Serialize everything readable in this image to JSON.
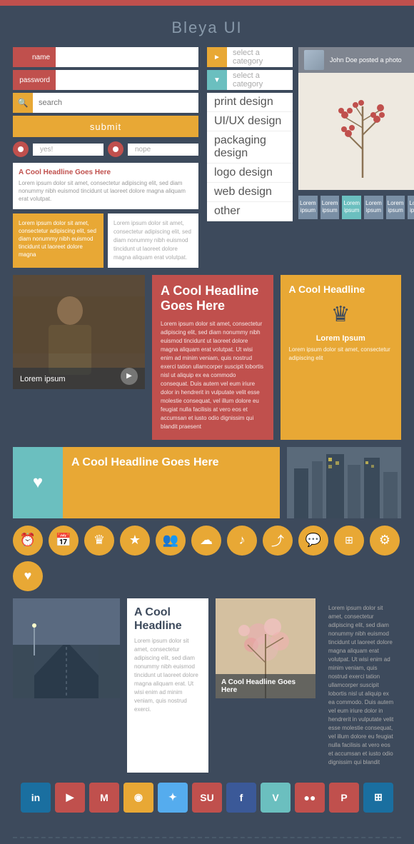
{
  "page": {
    "title": "Bleya UI"
  },
  "colors": {
    "red": "#c0504d",
    "yellow": "#e8a835",
    "teal": "#6bbfbf",
    "dark": "#3d4a5c",
    "gray": "#8899aa",
    "white": "#ffffff"
  },
  "header": {
    "title": "Bleya UI"
  },
  "form": {
    "name_label": "name",
    "name_placeholder": "",
    "password_label": "password",
    "password_placeholder": "",
    "search_placeholder": "search",
    "select_placeholder1": "select a category",
    "select_placeholder2": "select a category",
    "submit_label": "submit",
    "radio1_label": "yes!",
    "radio2_label": "nope"
  },
  "dropdown": {
    "items": [
      "print design",
      "UI/UX design",
      "packaging design",
      "logo design",
      "web design",
      "other"
    ]
  },
  "text_card": {
    "headline": "A Cool Headline Goes Here",
    "body": "Lorem ipsum dolor sit amet, consectetur adipiscing elit, sed diam nonummy nibh euismod tincidunt ut laoreet dolore magna aliquam erat volutpat."
  },
  "yellow_box": {
    "text": "Lorem ipsum dolor sit amet, consectetur adipiscing elit, sed diam nonummy nibh euismod tincidunt ut laoreet dolore magna"
  },
  "white_box": {
    "text": "Lorem ipsum dolor sit amet, consectetur adipiscing elit, sed diam nonummy nibh euismod tincidunt ut laoreet dolore magna aliquam erat volutpat."
  },
  "social_card": {
    "user": "John Doe posted a photo"
  },
  "tabs": [
    {
      "label": "Lorem\nipsum",
      "active": false
    },
    {
      "label": "Lorem\nipsum",
      "active": false
    },
    {
      "label": "Lorem\nipsum",
      "active": true
    },
    {
      "label": "Lorem\nipsum",
      "active": false
    },
    {
      "label": "Lorem\nipsum",
      "active": false
    },
    {
      "label": "Lorem\nipsum",
      "active": false
    }
  ],
  "photo_card": {
    "label": "Lorem ipsum"
  },
  "red_card": {
    "headline": "A Cool Headline Goes Here",
    "body": "Lorem ipsum dolor sit amet, consectetur adipiscing elit, sed diam nonummy nibh euismod tincidunt ut laoreet dolore magna aliquam erat volutpat. Ut wisi enim ad minim veniam, quis nostrud exerci tation ullamcorper suscipit lobortis nisl ut aliquip ex ea commodo consequat. Duis autem vel eum iriure dolor in hendrerit in vulputate velit esse molestie consequat, vel illum dolore eu feugiat nulla facilisis at vero eos et accumsan et iusto odio dignissim qui blandit praesent"
  },
  "yellow_card": {
    "headline": "A Cool Headline",
    "sub": "Lorem Ipsum",
    "body": "Lorem ipsum dolor sit amet, consectetur adipiscing elit"
  },
  "teal_card": {
    "headline": "A Cool Headline Goes Here"
  },
  "icons": [
    {
      "name": "alarm-icon",
      "symbol": "⏰"
    },
    {
      "name": "calendar-icon",
      "symbol": "📅"
    },
    {
      "name": "crown-icon",
      "symbol": "♛"
    },
    {
      "name": "star-icon",
      "symbol": "★"
    },
    {
      "name": "people-icon",
      "symbol": "👥"
    },
    {
      "name": "cloud-icon",
      "symbol": "☁"
    },
    {
      "name": "music-icon",
      "symbol": "♪"
    },
    {
      "name": "share-icon",
      "symbol": "⤴"
    },
    {
      "name": "chat-icon",
      "symbol": "💬"
    },
    {
      "name": "tag-icon",
      "symbol": "⊞"
    },
    {
      "name": "gear-icon",
      "symbol": "⚙"
    },
    {
      "name": "heart-icon",
      "symbol": "♥"
    }
  ],
  "bottom": {
    "headline1": "A Cool Headline",
    "body1": "Lorem ipsum dolor sit amet, consectetur adipiscing elit, sed diam nonummy nibh euismod tincidunt ut laoreet dolore magna aliquam erat. Ut wisi enim ad minim veniam, quis nostrud exerci.",
    "headline2": "A Cool Headline Goes Here",
    "body2": "Lorem ipsum dolor sit amet, consectetur adipiscing elit, sed diam nonummy nibh euismod tincidunt ut laoreet dolore magna aliquam erat volutpat. Ut wisi enim ad minim veniam, quis nostrud exerci tation ullamcorper suscipit lobortis nisl ut aliquip ex ea commodo. Duis autem vel eum iriure dolor in hendrerit in vulputate velit esse molestie consequat, vel illum dolore eu feugiat nulla facilisis at vero eos et accumsan et iusto odio dignissim qui blandit"
  },
  "social_icons": [
    {
      "name": "linkedin-icon",
      "label": "in",
      "color": "#1a6fa0"
    },
    {
      "name": "youtube-icon",
      "label": "▶",
      "color": "#c0504d"
    },
    {
      "name": "gmail-icon",
      "label": "M",
      "color": "#c0504d"
    },
    {
      "name": "rss-icon",
      "label": "◉",
      "color": "#e8a835"
    },
    {
      "name": "twitter-icon",
      "label": "✦",
      "color": "#55acee"
    },
    {
      "name": "stumbleupon-icon",
      "label": "SU",
      "color": "#c0504d"
    },
    {
      "name": "facebook-icon",
      "label": "f",
      "color": "#3b5998"
    },
    {
      "name": "vimeo-icon",
      "label": "V",
      "color": "#6bbfbf"
    },
    {
      "name": "flickr-icon",
      "label": "●●",
      "color": "#c0504d"
    },
    {
      "name": "pinterest-icon",
      "label": "P",
      "color": "#c0504d"
    },
    {
      "name": "delicious-icon",
      "label": "⊞",
      "color": "#1a6fa0"
    }
  ]
}
